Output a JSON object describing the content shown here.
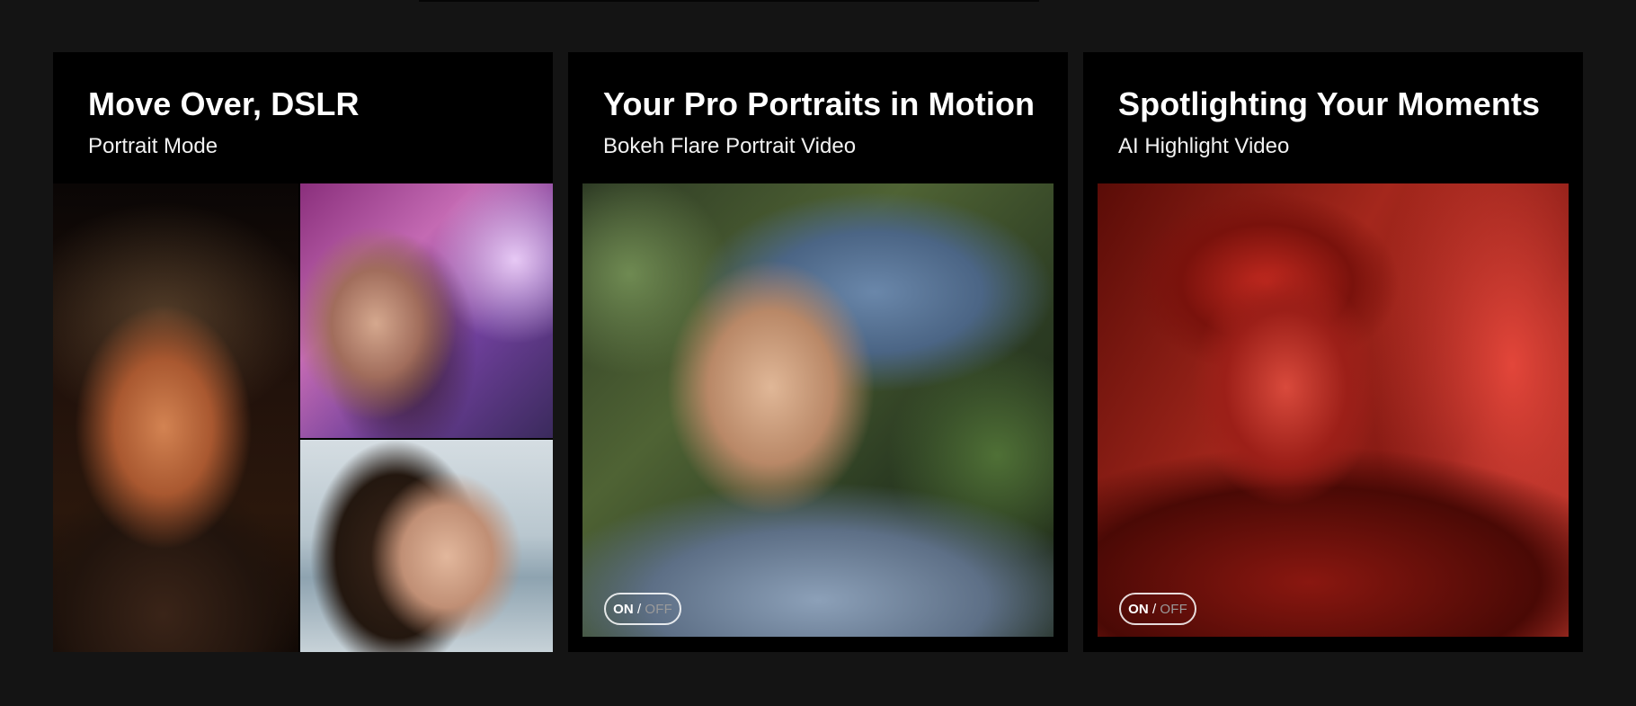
{
  "cards": [
    {
      "title": "Move Over, DSLR",
      "subtitle": "Portrait Mode"
    },
    {
      "title": "Your Pro Portraits in Motion",
      "subtitle": "Bokeh Flare Portrait Video",
      "toggle": {
        "on": "ON",
        "separator": "/",
        "off": "OFF"
      }
    },
    {
      "title": "Spotlighting Your Moments",
      "subtitle": "AI Highlight Video",
      "toggle": {
        "on": "ON",
        "separator": "/",
        "off": "OFF"
      }
    }
  ],
  "colors": {
    "page_background": "#141414",
    "card_background": "#000000",
    "text": "#ffffff",
    "toggle_off": "#9a9a9a"
  }
}
